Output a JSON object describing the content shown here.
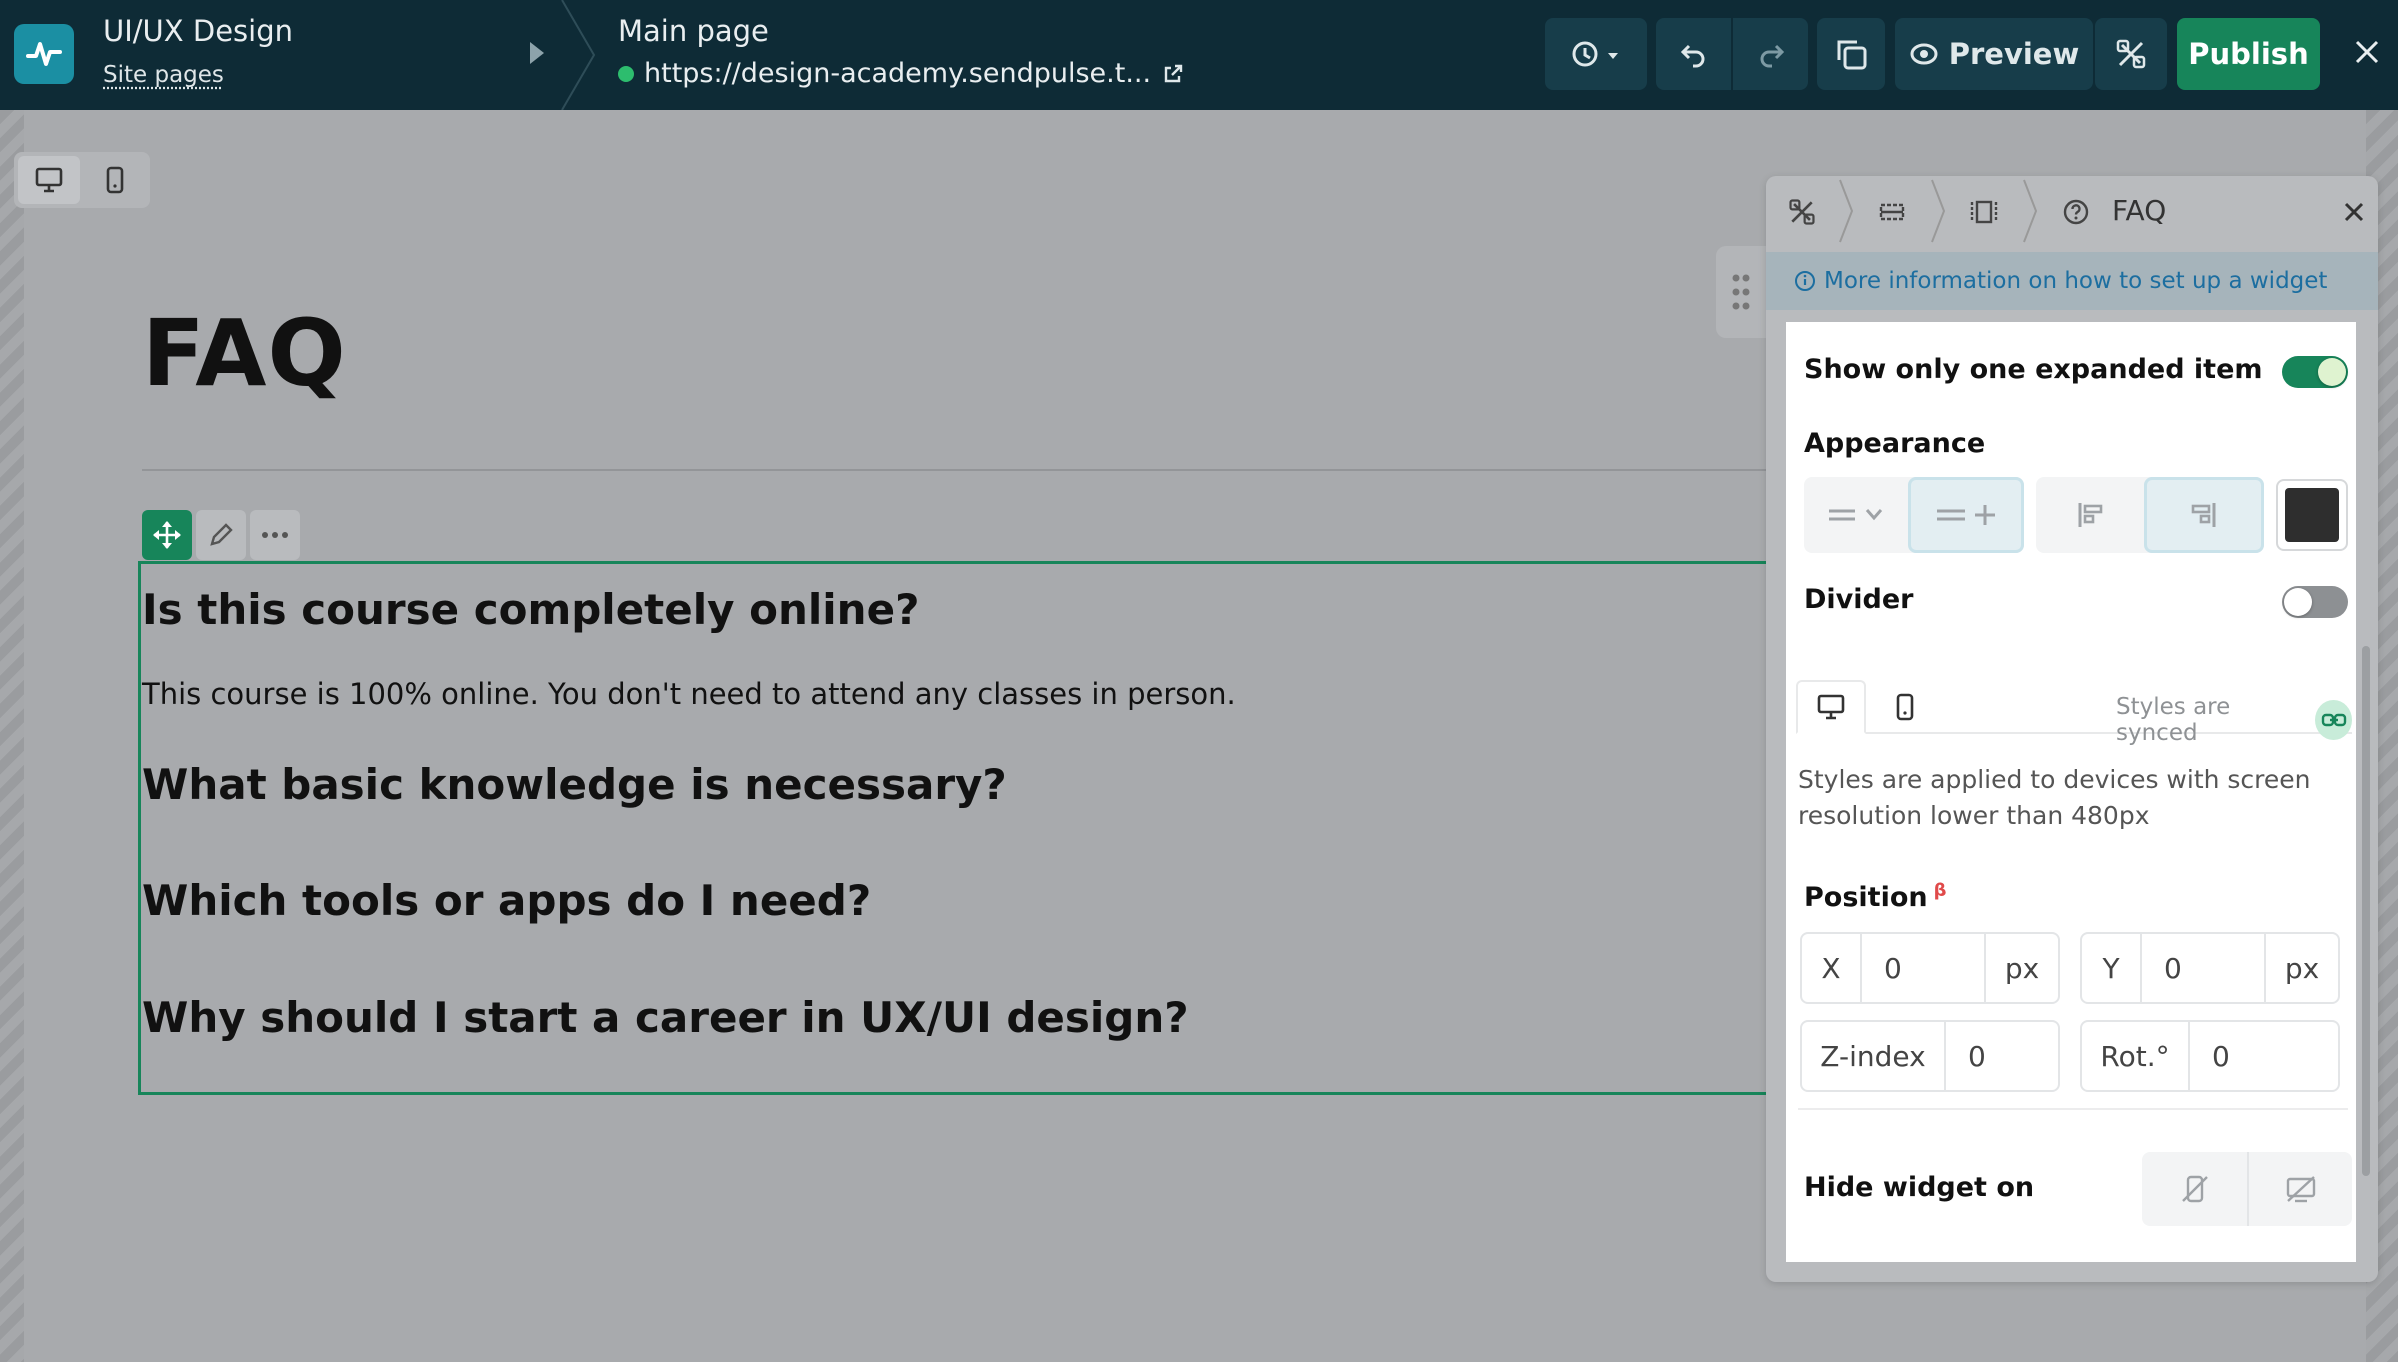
{
  "topbar": {
    "site_title": "UI/UX Design",
    "site_pages_label": "Site pages",
    "page_title": "Main page",
    "page_url": "https://design-academy.sendpulse.t...",
    "preview_label": "Preview",
    "publish_label": "Publish"
  },
  "canvas": {
    "heading": "FAQ",
    "questions": [
      "Is this course completely online?",
      "What basic knowledge is necessary?",
      "Which tools or apps do I need?",
      "Why should I start a career in UX/UI design?"
    ],
    "answer_1": "This course is 100% online. You don't need to attend any classes in person."
  },
  "panel": {
    "title": "FAQ",
    "info_link": "More information on how to set up a widget",
    "show_one_label": "Show only one expanded item",
    "show_one_on": true,
    "appearance_label": "Appearance",
    "divider_label": "Divider",
    "divider_on": false,
    "synced_label": "Styles are synced",
    "note": "Styles are applied to devices with screen resolution lower than 480px",
    "position_label": "Position",
    "beta_mark": "β",
    "x_label": "X",
    "x_value": "0",
    "y_label": "Y",
    "y_value": "0",
    "unit": "px",
    "z_label": "Z-index",
    "z_value": "0",
    "rot_label": "Rot.°",
    "rot_value": "0",
    "hide_label": "Hide widget on",
    "color_value": "#2e2e2e"
  },
  "colors": {
    "topbar": "#0e2b36",
    "accent_green": "#17855a",
    "link_blue": "#1c6ea0",
    "canvas_bg": "#a8aaad"
  },
  "icons": [
    "pulse-logo-icon",
    "history-icon",
    "undo-icon",
    "redo-icon",
    "copy-style-icon",
    "eye-icon",
    "tools-icon",
    "close-icon",
    "desktop-icon",
    "mobile-icon",
    "move-icon",
    "pencil-icon",
    "more-icon",
    "drag-handle-icon",
    "info-icon",
    "link-icon",
    "hide-mobile-icon",
    "hide-desktop-icon"
  ]
}
